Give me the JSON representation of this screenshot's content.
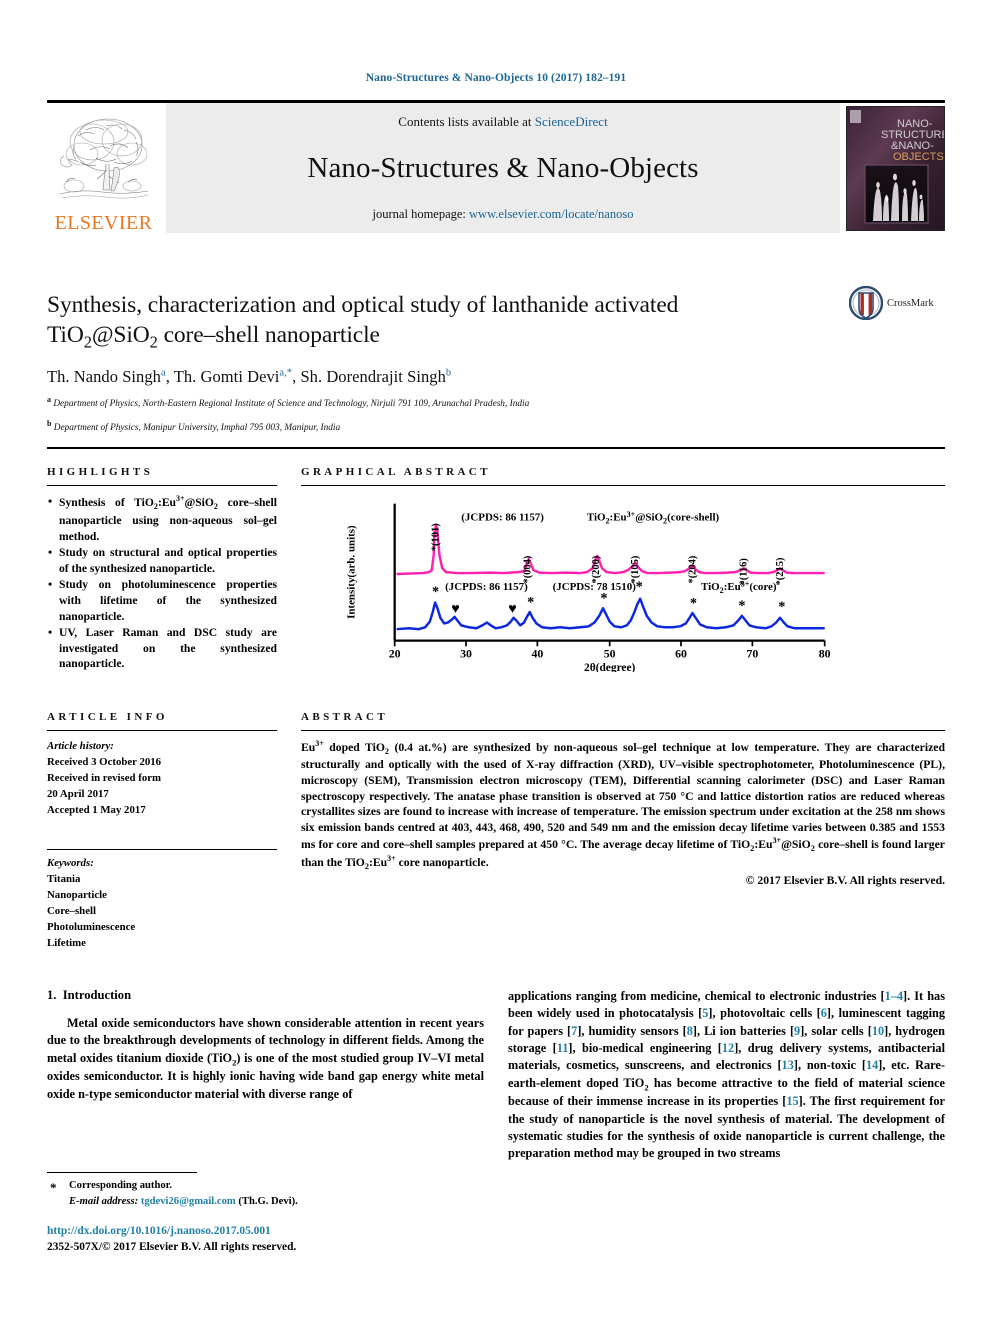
{
  "running_head": "Nano-Structures & Nano-Objects 10 (2017) 182–191",
  "masthead": {
    "publisher_logo_text": "ELSEVIER",
    "contents_prefix": "Contents lists available at ",
    "contents_link": "ScienceDirect",
    "journal_name": "Nano-Structures & Nano-Objects",
    "homepage_prefix": "journal homepage: ",
    "homepage_link": "www.elsevier.com/locate/nanoso",
    "cover_title_lines": [
      "NANO-",
      "STRUCTURES",
      "&NANO-",
      "OBJECTS"
    ]
  },
  "article": {
    "title_line1": "Synthesis, characterization and optical study of lanthanide activated",
    "title_line2_pre": "TiO",
    "title_line2_sub1": "2",
    "title_line2_mid": "@SiO",
    "title_line2_sub2": "2",
    "title_line2_post": " core–shell nanoparticle",
    "crossmark_label": "CrossMark",
    "authors": [
      {
        "name": "Th. Nando Singh",
        "marker": "a"
      },
      {
        "name": "Th. Gomti Devi",
        "marker": "a,*"
      },
      {
        "name": "Sh. Dorendrajit Singh",
        "marker": "b"
      }
    ],
    "affiliations": [
      {
        "marker": "a",
        "text": "Department of Physics, North-Eastern Regional Institute of Science and Technology, Nirjuli 791 109, Arunachal Pradesh, India"
      },
      {
        "marker": "b",
        "text": "Department of Physics, Manipur University, Imphal 795 003, Manipur, India"
      }
    ]
  },
  "highlights": {
    "heading": "HIGHLIGHTS",
    "items": [
      "Synthesis of TiO2:Eu3+@SiO2 core–shell nanoparticle using non-aqueous sol–gel method.",
      "Study on structural and optical properties of the synthesized nanoparticle.",
      "Study on photoluminescence properties with lifetime of the synthesized nanoparticle.",
      "UV, Laser Raman and DSC study are investigated on the synthesized nanoparticle."
    ]
  },
  "graphical_abstract": {
    "heading": "GRAPHICAL ABSTRACT"
  },
  "article_info": {
    "heading": "ARTICLE INFO",
    "history_label": "Article history:",
    "history": [
      "Received 3 October 2016",
      "Received in revised form",
      "20 April 2017",
      "Accepted 1 May 2017"
    ],
    "keywords_label": "Keywords:",
    "keywords": [
      "Titania",
      "Nanoparticle",
      "Core–shell",
      "Photoluminescence",
      "Lifetime"
    ]
  },
  "abstract": {
    "heading": "ABSTRACT",
    "text": "Eu3+ doped TiO2 (0.4 at.%) are synthesized by non-aqueous sol–gel technique at low temperature. They are characterized structurally and optically with the used of X-ray diffraction (XRD), UV–visible spectrophotometer, Photoluminescence (PL), microscopy (SEM), Transmission electron microscopy (TEM), Differential scanning calorimeter (DSC) and Laser Raman spectroscopy respectively. The anatase phase transition is observed at 750 °C and lattice distortion ratios are reduced whereas crystallites sizes are found to increase with increase of temperature. The emission spectrum under excitation at the 258 nm shows six emission bands centred at 403, 443, 468, 490, 520 and 549 nm and the emission decay lifetime varies between 0.385 and 1553 ms for core and core–shell samples prepared at 450 °C. The average decay lifetime of TiO2:Eu3+@SiO2 core–shell is found larger than the TiO2:Eu3+ core nanoparticle.",
    "copyright": "© 2017 Elsevier B.V. All rights reserved."
  },
  "body": {
    "section_number": "1.",
    "section_title": "Introduction",
    "left_paragraph": "Metal oxide semiconductors have shown considerable attention in recent years due to the breakthrough developments of technology in different fields. Among the metal oxides titanium dioxide (TiO2) is one of the most studied group IV–VI metal oxides semiconductor. It is highly ionic having wide band gap energy white metal oxide n-type semiconductor material with diverse range of",
    "right_paragraph": "applications ranging from medicine, chemical to electronic industries [1–4]. It has been widely used in photocatalysis [5], photovoltaic cells [6], luminescent tagging for papers [7], humidity sensors [8], Li ion batteries [9], solar cells [10], hydrogen storage [11], bio-medical engineering [12], drug delivery systems, antibacterial materials, cosmetics, sunscreens, and electronics [13], non-toxic [14], etc. Rare-earth-element doped TiO2 has become attractive to the field of material science because of their immense increase in its properties [15]. The first requirement for the study of nanoparticle is the novel synthesis of material. The development of systematic studies for the synthesis of oxide nanoparticle is current challenge, the preparation method may be grouped in two streams"
  },
  "footer": {
    "corresponding_label": "Corresponding author.",
    "email_label": "E-mail address:",
    "email": "tgdevi26@gmail.com",
    "email_suffix": "(Th.G. Devi).",
    "doi": "http://dx.doi.org/10.1016/j.nanoso.2017.05.001",
    "issn_line": "2352-507X/© 2017 Elsevier B.V. All rights reserved."
  },
  "chart_data": {
    "type": "line",
    "title": "",
    "xlabel": "2θ(degree)",
    "ylabel": "Intensity(arb. units)",
    "xlim": [
      20,
      80
    ],
    "xticks": [
      20,
      30,
      40,
      50,
      60,
      70,
      80
    ],
    "grid": false,
    "legend_position": "inline-annotations",
    "series": [
      {
        "name": "TiO2:Eu3+@SiO2(core-shell)",
        "color": "#FF22B0",
        "jcpds": "(JCPDS: 86 1157)",
        "label_text": "TiO2:Eu3+@SiO2(core-shell)",
        "peaks": [
          {
            "two_theta": 25.3,
            "hkl": "(101)",
            "rel_intensity": 100,
            "marker": "*"
          },
          {
            "two_theta": 37.8,
            "hkl": "(004)",
            "rel_intensity": 22,
            "marker": "*"
          },
          {
            "two_theta": 48.1,
            "hkl": "(200)",
            "rel_intensity": 26,
            "marker": "*"
          },
          {
            "two_theta": 53.9,
            "hkl": "(105)",
            "rel_intensity": 18,
            "marker": "*"
          },
          {
            "two_theta": 62.7,
            "hkl": "(204)",
            "rel_intensity": 14,
            "marker": "*"
          },
          {
            "two_theta": 69.0,
            "hkl": "(116)",
            "rel_intensity": 8,
            "marker": "*"
          },
          {
            "two_theta": 75.2,
            "hkl": "(215)",
            "rel_intensity": 8,
            "marker": "*"
          }
        ]
      },
      {
        "name": "TiO2:Eu3+(core)",
        "color": "#0D28E0",
        "jcpds": "(JCPDS: 86 1157)",
        "jcpds2": "(JCPDS: 78 1510)",
        "label_text": "TiO2:Eu3+(core)",
        "peaks": [
          {
            "two_theta": 25.3,
            "rel_intensity": 100,
            "marker": "*"
          },
          {
            "two_theta": 27.8,
            "rel_intensity": 24,
            "marker": "♥"
          },
          {
            "two_theta": 36.5,
            "rel_intensity": 22,
            "marker": "♥"
          },
          {
            "two_theta": 38.0,
            "rel_intensity": 30,
            "marker": "*"
          },
          {
            "two_theta": 48.2,
            "rel_intensity": 40,
            "marker": "*"
          },
          {
            "two_theta": 54.3,
            "rel_intensity": 52,
            "marker": "*"
          },
          {
            "two_theta": 62.6,
            "rel_intensity": 28,
            "marker": "*"
          },
          {
            "two_theta": 69.2,
            "rel_intensity": 22,
            "marker": "*"
          },
          {
            "two_theta": 75.3,
            "rel_intensity": 20,
            "marker": "*"
          }
        ]
      }
    ]
  }
}
